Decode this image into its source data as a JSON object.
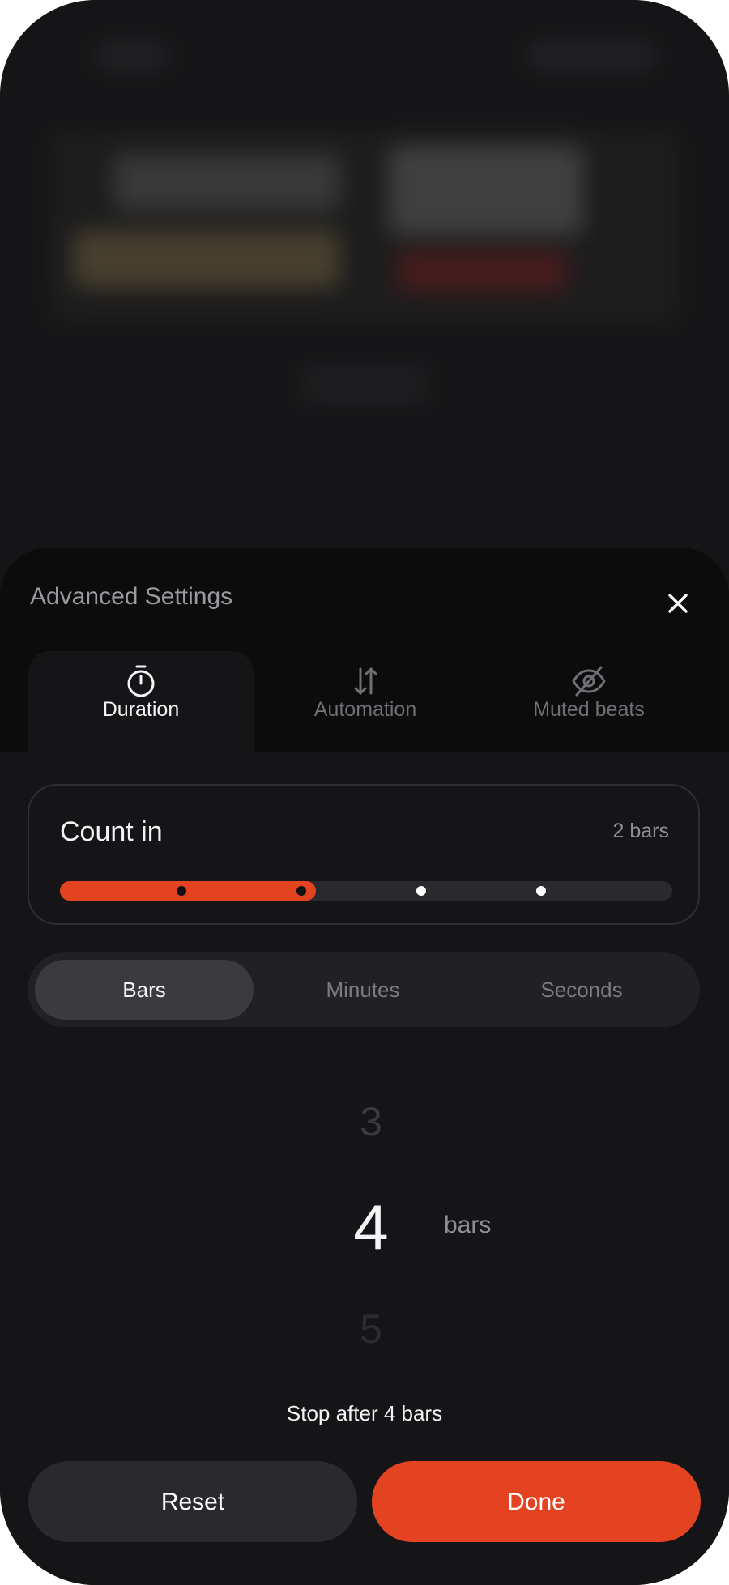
{
  "sheet": {
    "title": "Advanced Settings",
    "tabs": [
      {
        "label": "Duration",
        "icon": "stopwatch-icon",
        "active": true
      },
      {
        "label": "Automation",
        "icon": "swap-vertical-icon",
        "active": false
      },
      {
        "label": "Muted beats",
        "icon": "eye-off-icon",
        "active": false
      }
    ]
  },
  "count_in": {
    "label": "Count in",
    "value_text": "2 bars",
    "selected_steps": 2,
    "total_steps": 4
  },
  "unit_selector": {
    "options": [
      "Bars",
      "Minutes",
      "Seconds"
    ],
    "selected": "Bars"
  },
  "picker": {
    "previous": "3",
    "current": "4",
    "next": "5",
    "unit": "bars"
  },
  "summary": "Stop after 4 bars",
  "buttons": {
    "reset": "Reset",
    "done": "Done"
  },
  "colors": {
    "accent": "#e44322",
    "sheet_bg": "#151517"
  }
}
